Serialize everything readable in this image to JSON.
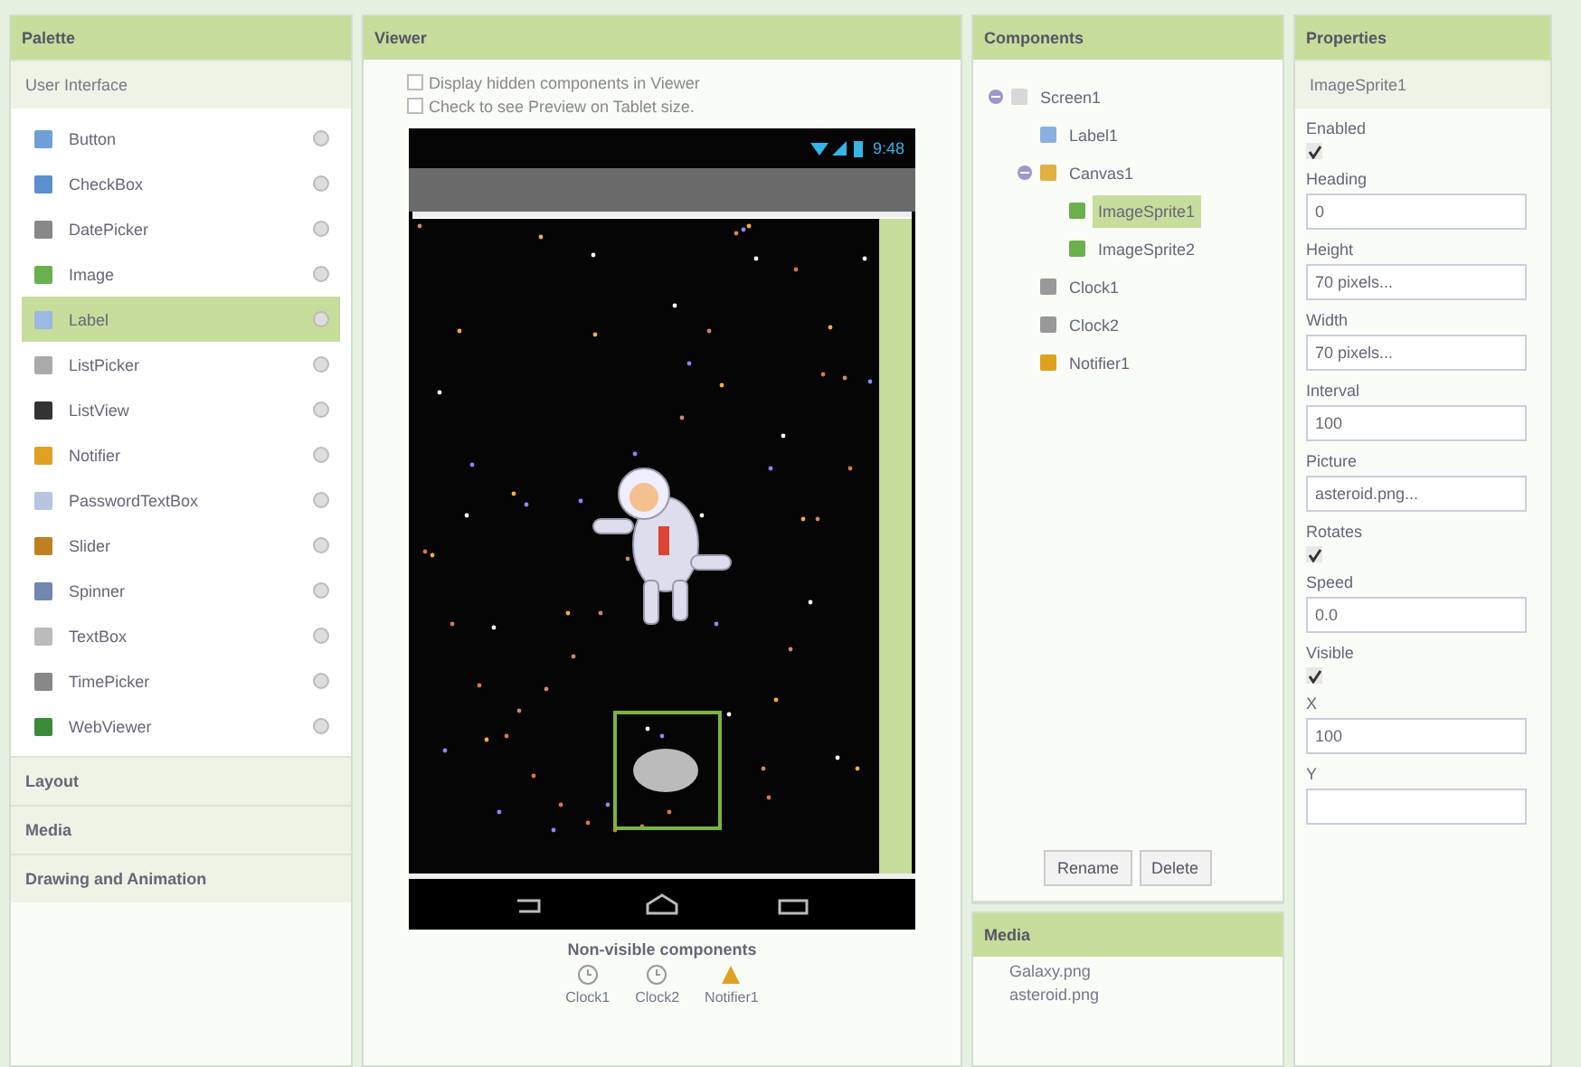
{
  "palette": {
    "title": "Palette",
    "open_group": "User Interface",
    "items": [
      {
        "label": "Button",
        "selected": false
      },
      {
        "label": "CheckBox",
        "selected": false
      },
      {
        "label": "DatePicker",
        "selected": false
      },
      {
        "label": "Image",
        "selected": false
      },
      {
        "label": "Label",
        "selected": true
      },
      {
        "label": "ListPicker",
        "selected": false
      },
      {
        "label": "ListView",
        "selected": false
      },
      {
        "label": "Notifier",
        "selected": false
      },
      {
        "label": "PasswordTextBox",
        "selected": false
      },
      {
        "label": "Slider",
        "selected": false
      },
      {
        "label": "Spinner",
        "selected": false
      },
      {
        "label": "TextBox",
        "selected": false
      },
      {
        "label": "TimePicker",
        "selected": false
      },
      {
        "label": "WebViewer",
        "selected": false
      }
    ],
    "closed_groups": [
      "Layout",
      "Media",
      "Drawing and Animation"
    ]
  },
  "viewer": {
    "title": "Viewer",
    "options": [
      {
        "label": "Display hidden components in Viewer",
        "checked": false
      },
      {
        "label": "Check to see Preview on Tablet size.",
        "checked": false
      }
    ],
    "phone": {
      "time": "9:48"
    },
    "non_visible_title": "Non-visible components",
    "non_visible": [
      {
        "label": "Clock1",
        "kind": "clock"
      },
      {
        "label": "Clock2",
        "kind": "clock"
      },
      {
        "label": "Notifier1",
        "kind": "notifier"
      }
    ]
  },
  "components": {
    "title": "Components",
    "tree": [
      {
        "label": "Screen1",
        "kind": "screen",
        "expanded": true,
        "selected": false,
        "children": [
          {
            "label": "Label1",
            "kind": "label",
            "selected": false
          },
          {
            "label": "Canvas1",
            "kind": "canvas",
            "expanded": true,
            "selected": false,
            "children": [
              {
                "label": "ImageSprite1",
                "kind": "sprite",
                "selected": true
              },
              {
                "label": "ImageSprite2",
                "kind": "sprite",
                "selected": false
              }
            ]
          },
          {
            "label": "Clock1",
            "kind": "clock",
            "selected": false
          },
          {
            "label": "Clock2",
            "kind": "clock",
            "selected": false
          },
          {
            "label": "Notifier1",
            "kind": "notifier",
            "selected": false
          }
        ]
      }
    ],
    "buttons": [
      "Rename",
      "Delete"
    ]
  },
  "media": {
    "title": "Media",
    "files": [
      "Galaxy.png",
      "asteroid.png"
    ]
  },
  "properties": {
    "title": "Properties",
    "component": "ImageSprite1",
    "items": [
      {
        "kind": "checkbox",
        "label": "Enabled",
        "checked": true
      },
      {
        "kind": "text",
        "label": "Heading",
        "value": "0"
      },
      {
        "kind": "text",
        "label": "Height",
        "value": "70 pixels..."
      },
      {
        "kind": "text",
        "label": "Width",
        "value": "70 pixels..."
      },
      {
        "kind": "text",
        "label": "Interval",
        "value": "100"
      },
      {
        "kind": "text",
        "label": "Picture",
        "value": "asteroid.png..."
      },
      {
        "kind": "checkbox",
        "label": "Rotates",
        "checked": true
      },
      {
        "kind": "text",
        "label": "Speed",
        "value": "0.0"
      },
      {
        "kind": "checkbox",
        "label": "Visible",
        "checked": true
      },
      {
        "kind": "text",
        "label": "X",
        "value": "100"
      },
      {
        "kind": "text",
        "label": "Y"
      }
    ]
  }
}
